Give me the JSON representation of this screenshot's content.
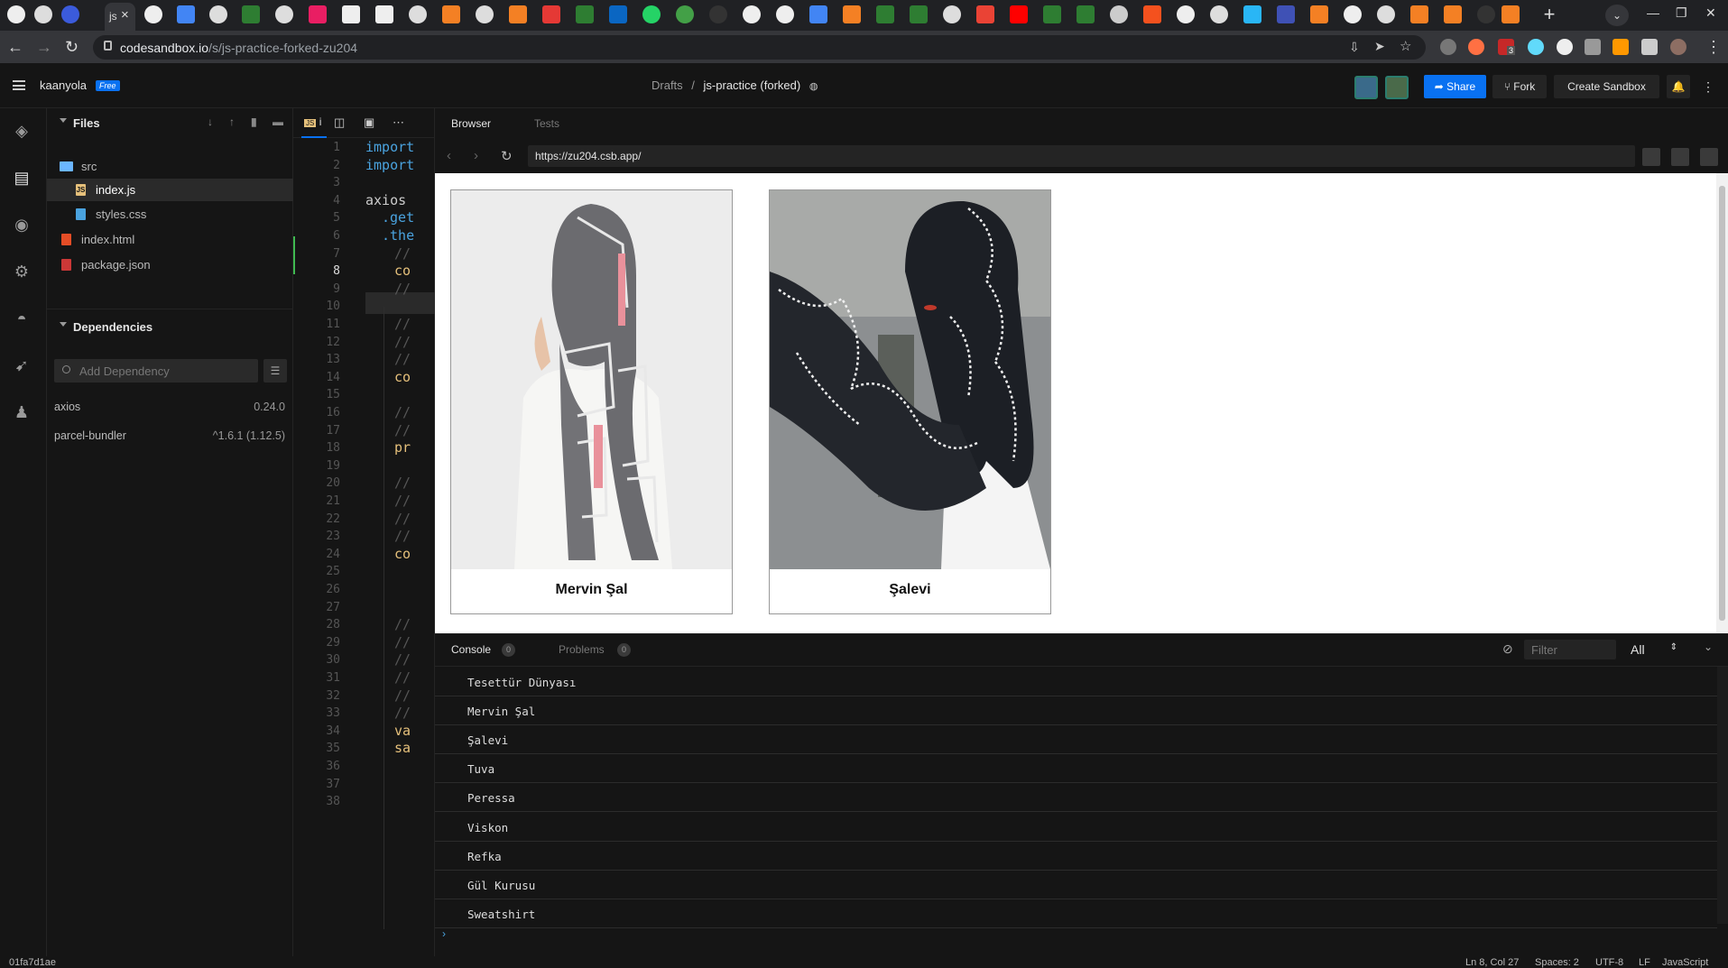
{
  "browser_chrome": {
    "active_tab_label": "js",
    "url_host": "codesandbox.io",
    "url_path": "/s/js-practice-forked-zu204",
    "extension_badge": "3"
  },
  "header": {
    "username": "kaanyola",
    "plan": "Free",
    "breadcrumb_parent": "Drafts",
    "breadcrumb_sep": "/",
    "sandbox_name": "js-practice (forked)",
    "share_label": "Share",
    "fork_label": "Fork",
    "create_label": "Create Sandbox"
  },
  "explorer": {
    "files_header": "Files",
    "files": [
      {
        "name": "src",
        "type": "folder"
      },
      {
        "name": "index.js",
        "type": "js"
      },
      {
        "name": "styles.css",
        "type": "css"
      },
      {
        "name": "index.html",
        "type": "html"
      },
      {
        "name": "package.json",
        "type": "json"
      }
    ],
    "dependencies_header": "Dependencies",
    "dep_placeholder": "Add Dependency",
    "dependencies": [
      {
        "name": "axios",
        "version": "0.24.0"
      },
      {
        "name": "parcel-bundler",
        "version": "^1.6.1 (1.12.5)"
      }
    ]
  },
  "editor": {
    "tab_label": "i",
    "line_numbers": [
      "1",
      "2",
      "3",
      "4",
      "5",
      "6",
      "7",
      "8",
      "9",
      "10",
      "11",
      "12",
      "13",
      "14",
      "15",
      "16",
      "17",
      "18",
      "19",
      "20",
      "21",
      "22",
      "23",
      "24",
      "25",
      "26",
      "27",
      "28",
      "29",
      "30",
      "31",
      "32",
      "33",
      "34",
      "35",
      "36",
      "37",
      "38"
    ],
    "current_line": "8",
    "code": {
      "l1": "import",
      "l2": "import",
      "l4": "axios",
      "l5": ".get",
      "l6": ".the",
      "l7": "//",
      "l8": "co",
      "l9": "//",
      "l11": "//",
      "l12": "//",
      "l13": "//",
      "l14": "co",
      "l16": "//",
      "l17": "//",
      "l18": "pr",
      "l20": "//",
      "l21": "//",
      "l22": "//",
      "l23": "//",
      "l24": "co",
      "l28": "//",
      "l29": "//",
      "l30": "//",
      "l31": "//",
      "l32": "//",
      "l33": "//",
      "l34": "va",
      "l35": "sa"
    }
  },
  "browser": {
    "tab_browser": "Browser",
    "tab_tests": "Tests",
    "url": "https://zu204.csb.app/",
    "cards": [
      {
        "caption": "Mervin Şal"
      },
      {
        "caption": "Şalevi"
      }
    ]
  },
  "console": {
    "tab_console": "Console",
    "console_count": "0",
    "tab_problems": "Problems",
    "problems_count": "0",
    "filter_placeholder": "Filter",
    "level": "All",
    "logs": [
      "Tesettür Dünyası",
      "Mervin Şal",
      "Şalevi",
      "Tuva",
      "Peressa",
      "Viskon",
      "Refka",
      "Gül Kurusu",
      "Sweatshirt"
    ],
    "prompt": "›"
  },
  "status": {
    "commit": "01fa7d1ae",
    "position": "Ln 8, Col 27",
    "spaces": "Spaces: 2",
    "encoding": "UTF-8",
    "eol": "LF",
    "language": "JavaScript"
  },
  "colors": {
    "accent": "#0971f1",
    "background": "#151515",
    "panel_border": "#242424"
  }
}
